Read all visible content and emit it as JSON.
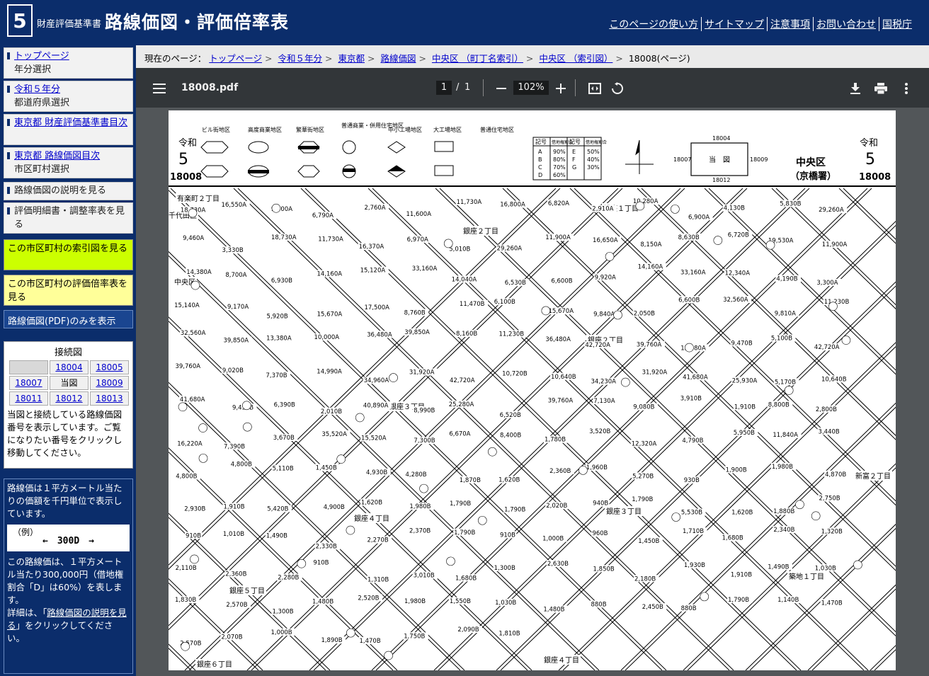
{
  "header": {
    "logo_number": "5",
    "subtitle": "財産評価基準書",
    "title": "路線価図・評価倍率表",
    "links": [
      "このページの使い方",
      "サイトマップ",
      "注意事項",
      "お問い合わせ",
      "国税庁"
    ]
  },
  "sidebar": {
    "items": [
      {
        "link": "トップページ",
        "sub": "年分選択"
      },
      {
        "link": "令和５年分",
        "sub": "都道府県選択"
      },
      {
        "link": "東京都 財産評価基準書目次",
        "sub": ""
      },
      {
        "link": "東京都 路線価図目次",
        "sub": "市区町村選択"
      },
      {
        "link": "",
        "sub": "路線価図の説明を見る"
      },
      {
        "link": "",
        "sub": "評価明細書・調整率表を見る"
      }
    ],
    "index_map_button": "この市区町村の索引図を見る",
    "rate_table_button": "この市区町村の評価倍率表を見る",
    "pdf_only_button": "路線価図(PDF)のみを表示",
    "connection": {
      "title": "接続図",
      "cells": [
        "",
        "18004",
        "18005",
        "18007",
        "当図",
        "18009",
        "18011",
        "18012",
        "18013"
      ],
      "note": "当図と接続している路線価図番号を表示しています。ご覧になりたい番号をクリックし移動してください。"
    },
    "info": {
      "text1": "路線価は１平方メートル当たりの価額を千円単位で表示しています。",
      "example_label": "（例）",
      "example_value": "←　300D　→",
      "text2": "この路線価は、１平方メートル当たり300,000円（借地権割合「D」は60%）を表します。",
      "text3_prefix": "詳細は、「",
      "text3_link": "路線価図の説明を見る",
      "text3_suffix": "」をクリックしてください。"
    }
  },
  "breadcrumb": {
    "label": "現在のページ：",
    "items": [
      "トップページ",
      "令和５年分",
      "東京都",
      "路線価図",
      "中央区 （町丁名索引）",
      "中央区 （索引図）"
    ],
    "current": "18008(ページ)"
  },
  "pdf": {
    "filename": "18008.pdf",
    "page_current": "1",
    "page_total": "1",
    "zoom": "102%"
  },
  "map": {
    "era_left": "令和",
    "num_left": "5",
    "code_left": "18008",
    "era_right": "令和",
    "num_right": "5",
    "code_right": "18008",
    "ward": "中央区",
    "office": "（京橋署）",
    "center_label": "当　図",
    "adj_top": "18004",
    "adj_left": "18007",
    "adj_right": "18009",
    "adj_bottom": "18012",
    "districts": [
      "ビル街地区",
      "高度商業地区",
      "繁華街地区",
      "普通商業・併用住宅地区",
      "中小工場地区",
      "大工場地区",
      "普通住宅地区"
    ],
    "rate_header": [
      "記号",
      "借地権割合",
      "記号",
      "借地権割合"
    ],
    "rate_rows": [
      [
        "A",
        "90%",
        "E",
        "50%"
      ],
      [
        "B",
        "80%",
        "F",
        "40%"
      ],
      [
        "C",
        "70%",
        "G",
        "30%"
      ],
      [
        "D",
        "60%",
        "",
        ""
      ]
    ],
    "place_labels": [
      "有楽町２丁目",
      "千代田区",
      "中央区",
      "銀座１丁目",
      "銀座２丁目",
      "銀座２丁目",
      "銀座３丁目",
      "銀座３丁目",
      "銀座４丁目",
      "銀座４丁目",
      "銀座５丁目",
      "銀座６丁目",
      "新富２丁目",
      "築地１丁目"
    ],
    "prices": [
      "18,730A",
      "16,550A",
      "9,500A",
      "6,790A",
      "2,760A",
      "11,600A",
      "11,730A",
      "16,800A",
      "6,820A",
      "2,910A",
      "10,280A",
      "6,900A",
      "4,130B",
      "5,830B",
      "29,260A",
      "9,460A",
      "3,330B",
      "18,730A",
      "11,730A",
      "16,370A",
      "6,970A",
      "5,010B",
      "29,260A",
      "11,900A",
      "16,650A",
      "8,150A",
      "8,630B",
      "6,720B",
      "19,530A",
      "11,900A",
      "14,380A",
      "8,700A",
      "6,930B",
      "14,160A",
      "15,120A",
      "33,160A",
      "14,040A",
      "6,530B",
      "6,600B",
      "9,920A",
      "14,160A",
      "33,160A",
      "12,340A",
      "4,190B",
      "3,300A",
      "15,140A",
      "9,170A",
      "5,920B",
      "15,670A",
      "17,500A",
      "8,760B",
      "11,470B",
      "6,100B",
      "15,670A",
      "9,840A",
      "2,050B",
      "6,600B",
      "32,560A",
      "9,810A",
      "11,230B",
      "32,560A",
      "39,850A",
      "13,380A",
      "10,000A",
      "36,480A",
      "39,850A",
      "8,160B",
      "11,230B",
      "36,480A",
      "42,720A",
      "39,760A",
      "12,480A",
      "9,470B",
      "5,100B",
      "42,720A",
      "39,760A",
      "9,020B",
      "7,370B",
      "14,990A",
      "34,960A",
      "31,920A",
      "42,720A",
      "10,720B",
      "10,640B",
      "34,230A",
      "31,920A",
      "41,680A",
      "25,930A",
      "5,170B",
      "10,640B",
      "41,680A",
      "9,450B",
      "6,390B",
      "2,010B",
      "40,890A",
      "8,990B",
      "25,280A",
      "6,520B",
      "39,760A",
      "7,130A",
      "9,080B",
      "3,910B",
      "1,910B",
      "8,800B",
      "2,800B",
      "16,220A",
      "7,390B",
      "3,670B",
      "35,520A",
      "15,520A",
      "7,300B",
      "6,670A",
      "8,400B",
      "1,780B",
      "3,520B",
      "12,320A",
      "4,790B",
      "5,950B",
      "11,840A",
      "3,440B",
      "4,800B",
      "4,800B",
      "5,110B",
      "1,450B",
      "4,930B",
      "4,280B",
      "1,870B",
      "1,620B",
      "2,360B",
      "1,960B",
      "5,270B",
      "930B",
      "1,900B",
      "1,980B",
      "4,870B",
      "2,930B",
      "1,910B",
      "5,420B",
      "4,900B",
      "1,620B",
      "1,980B",
      "1,790B",
      "1,790B",
      "2,020B",
      "940B",
      "1,790B",
      "5,530B",
      "1,620B",
      "1,880B",
      "2,750B",
      "910B",
      "1,010B",
      "1,490B",
      "2,330B",
      "2,270B",
      "2,370B",
      "1,790B",
      "910B",
      "1,000B",
      "960B",
      "1,450B",
      "1,710B",
      "1,680B",
      "2,340B",
      "1,320B",
      "2,110B",
      "2,360B",
      "2,280B",
      "910B",
      "1,310B",
      "3,010B",
      "1,680B",
      "1,300B",
      "2,630B",
      "1,850B",
      "2,180B",
      "1,930B",
      "1,910B",
      "1,490B",
      "1,030B",
      "1,830B",
      "2,570B",
      "1,300B",
      "1,480B",
      "2,520B",
      "1,980B",
      "1,550B",
      "1,030B",
      "1,480B",
      "880B",
      "2,450B",
      "880B",
      "1,790B",
      "1,140B",
      "1,470B",
      "2,570B",
      "2,070B",
      "1,000B",
      "1,890B",
      "1,470B",
      "1,750B",
      "2,090B",
      "1,810B"
    ]
  }
}
